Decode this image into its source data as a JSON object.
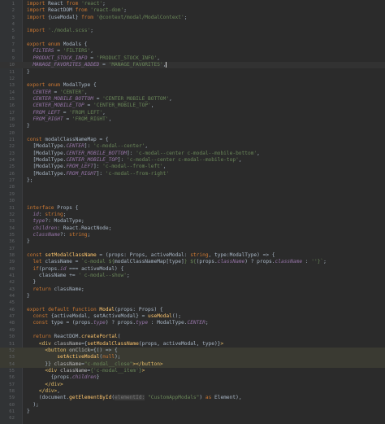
{
  "editor": {
    "theme": {
      "background": "#2b2b2b",
      "gutter": "#313335",
      "highlight_line": "#3a3a32",
      "keyword": "#cc7832",
      "string": "#6a8759",
      "property": "#9876aa",
      "function": "#ffc66d",
      "tag": "#e8bf6a",
      "default": "#a9b7c6"
    },
    "lines": [
      {
        "n": "1",
        "t": [
          [
            "kw",
            "import "
          ],
          [
            "",
            "React "
          ],
          [
            "kw",
            "from "
          ],
          [
            "str",
            "'react'"
          ],
          [
            "",
            ";"
          ]
        ]
      },
      {
        "n": "2",
        "t": [
          [
            "kw",
            "import "
          ],
          [
            "",
            "ReactDOM "
          ],
          [
            "kw",
            "from "
          ],
          [
            "str",
            "'react-dom'"
          ],
          [
            "",
            ";"
          ]
        ]
      },
      {
        "n": "3",
        "t": [
          [
            "kw",
            "import "
          ],
          [
            "",
            "{useModal} "
          ],
          [
            "kw",
            "from "
          ],
          [
            "str",
            "'@context/modal/ModalContext'"
          ],
          [
            "",
            ";"
          ]
        ]
      },
      {
        "n": "4",
        "t": []
      },
      {
        "n": "5",
        "t": [
          [
            "kw",
            "import "
          ],
          [
            "str",
            "'./modal.scss'"
          ],
          [
            "",
            ";"
          ]
        ]
      },
      {
        "n": "6",
        "t": []
      },
      {
        "n": "7",
        "t": [
          [
            "kw",
            "export enum "
          ],
          [
            "",
            "Modals {"
          ]
        ]
      },
      {
        "n": "8",
        "t": [
          [
            "",
            "  "
          ],
          [
            "prop",
            "FILTERS"
          ],
          [
            "",
            " = "
          ],
          [
            "str",
            "'FILTERS'"
          ],
          [
            "",
            ","
          ]
        ]
      },
      {
        "n": "9",
        "t": [
          [
            "",
            "  "
          ],
          [
            "prop",
            "PRODUCT_STOCK_INFO"
          ],
          [
            "",
            " = "
          ],
          [
            "str",
            "'PRODUCT_STOCK_INFO'"
          ],
          [
            "",
            ","
          ]
        ]
      },
      {
        "n": "10",
        "t": [
          [
            "",
            "  "
          ],
          [
            "prop",
            "MANAGE_FAVORITES_ADDED"
          ],
          [
            "",
            " = "
          ],
          [
            "str",
            "'MANAGE_FAVORITES'"
          ],
          [
            "",
            ","
          ]
        ],
        "cur": true
      },
      {
        "n": "11",
        "t": [
          [
            "",
            "}"
          ]
        ]
      },
      {
        "n": "12",
        "t": []
      },
      {
        "n": "13",
        "t": [
          [
            "kw",
            "export enum "
          ],
          [
            "",
            "ModalType {"
          ]
        ]
      },
      {
        "n": "14",
        "t": [
          [
            "",
            "  "
          ],
          [
            "prop",
            "CENTER"
          ],
          [
            "",
            " = "
          ],
          [
            "str",
            "'CENTER'"
          ],
          [
            "",
            ","
          ]
        ]
      },
      {
        "n": "15",
        "t": [
          [
            "",
            "  "
          ],
          [
            "prop",
            "CENTER_MOBILE_BOTTOM"
          ],
          [
            "",
            " = "
          ],
          [
            "str",
            "'CENTER_MOBILE_BOTTOM'"
          ],
          [
            "",
            ","
          ]
        ]
      },
      {
        "n": "16",
        "t": [
          [
            "",
            "  "
          ],
          [
            "prop",
            "CENTER_MOBILE_TOP"
          ],
          [
            "",
            " = "
          ],
          [
            "str",
            "'CENTER_MOBILE_TOP'"
          ],
          [
            "",
            ","
          ]
        ]
      },
      {
        "n": "17",
        "t": [
          [
            "",
            "  "
          ],
          [
            "prop",
            "FROM_LEFT"
          ],
          [
            "",
            " = "
          ],
          [
            "str",
            "'FROM_LEFT'"
          ],
          [
            "",
            ","
          ]
        ]
      },
      {
        "n": "18",
        "t": [
          [
            "",
            "  "
          ],
          [
            "prop",
            "FROM_RIGHT"
          ],
          [
            "",
            " = "
          ],
          [
            "str",
            "'FROM_RIGHT'"
          ],
          [
            "",
            ","
          ]
        ]
      },
      {
        "n": "19",
        "t": [
          [
            "",
            "}"
          ]
        ]
      },
      {
        "n": "20",
        "t": []
      },
      {
        "n": "21",
        "t": [
          [
            "kw",
            "const "
          ],
          [
            "",
            "modalClassNameMap = {"
          ]
        ]
      },
      {
        "n": "22",
        "t": [
          [
            "",
            "  [ModalType."
          ],
          [
            "prop",
            "CENTER"
          ],
          [
            "",
            "]: "
          ],
          [
            "str",
            "'c-modal--center'"
          ],
          [
            "",
            ","
          ]
        ]
      },
      {
        "n": "23",
        "t": [
          [
            "",
            "  [ModalType."
          ],
          [
            "prop",
            "CENTER_MOBILE_BOTTOM"
          ],
          [
            "",
            "]: "
          ],
          [
            "str",
            "'c-modal--center c-modal--mobile-bottom'"
          ],
          [
            "",
            ","
          ]
        ]
      },
      {
        "n": "24",
        "t": [
          [
            "",
            "  [ModalType."
          ],
          [
            "prop",
            "CENTER_MOBILE_TOP"
          ],
          [
            "",
            "]: "
          ],
          [
            "str",
            "'c-modal--center c-modal--mobile-top'"
          ],
          [
            "",
            ","
          ]
        ]
      },
      {
        "n": "25",
        "t": [
          [
            "",
            "  [ModalType."
          ],
          [
            "prop",
            "FROM_LEFT"
          ],
          [
            "",
            "]: "
          ],
          [
            "str",
            "'c-modal--from-left'"
          ],
          [
            "",
            ","
          ]
        ]
      },
      {
        "n": "26",
        "t": [
          [
            "",
            "  [ModalType."
          ],
          [
            "prop",
            "FROM_RIGHT"
          ],
          [
            "",
            "]: "
          ],
          [
            "str",
            "'c-modal--from-right'"
          ]
        ]
      },
      {
        "n": "27",
        "t": [
          [
            "",
            "}"
          ],
          [
            "",
            ";"
          ]
        ]
      },
      {
        "n": "28",
        "t": []
      },
      {
        "n": "29",
        "t": []
      },
      {
        "n": "30",
        "t": []
      },
      {
        "n": "31",
        "t": [
          [
            "kw",
            "interface "
          ],
          [
            "",
            "Props {"
          ]
        ]
      },
      {
        "n": "32",
        "t": [
          [
            "",
            "  "
          ],
          [
            "prop",
            "id"
          ],
          [
            "",
            ": "
          ],
          [
            "kw",
            "string"
          ],
          [
            "",
            ";"
          ]
        ]
      },
      {
        "n": "33",
        "t": [
          [
            "",
            "  "
          ],
          [
            "prop",
            "type"
          ],
          [
            "",
            "?: ModalType;"
          ]
        ]
      },
      {
        "n": "34",
        "t": [
          [
            "",
            "  "
          ],
          [
            "prop",
            "children"
          ],
          [
            "",
            ": React.ReactNode;"
          ]
        ]
      },
      {
        "n": "35",
        "t": [
          [
            "",
            "  "
          ],
          [
            "prop",
            "className"
          ],
          [
            "",
            "?: "
          ],
          [
            "kw",
            "string"
          ],
          [
            "",
            ";"
          ]
        ]
      },
      {
        "n": "36",
        "t": [
          [
            "",
            "}"
          ]
        ]
      },
      {
        "n": "37",
        "t": []
      },
      {
        "n": "38",
        "t": [
          [
            "kw",
            "const "
          ],
          [
            "fn",
            "setModalClassName"
          ],
          [
            "",
            " = (props: Props, activeModal: "
          ],
          [
            "kw",
            "string"
          ],
          [
            "",
            ", type:ModalType) => {"
          ]
        ]
      },
      {
        "n": "39",
        "t": [
          [
            "",
            "  "
          ],
          [
            "kw",
            "let "
          ],
          [
            "",
            "className = "
          ],
          [
            "str",
            "`c-modal ${"
          ],
          [
            "",
            "modalClassNameMap[type]"
          ],
          [
            "str",
            "} ${"
          ],
          [
            "",
            "(props."
          ],
          [
            "prop",
            "className"
          ],
          [
            "",
            ") ? props."
          ],
          [
            "prop",
            "className"
          ],
          [
            "",
            " : "
          ],
          [
            "str",
            "''"
          ],
          [
            "str",
            "}`"
          ],
          [
            "",
            ";"
          ]
        ]
      },
      {
        "n": "40",
        "t": [
          [
            "",
            "  "
          ],
          [
            "kw",
            "if"
          ],
          [
            "",
            "(props."
          ],
          [
            "prop",
            "id"
          ],
          [
            "",
            " === activeModal) {"
          ]
        ]
      },
      {
        "n": "41",
        "t": [
          [
            "",
            "    className += "
          ],
          [
            "str",
            "' c-modal--show'"
          ],
          [
            "",
            ";"
          ]
        ]
      },
      {
        "n": "42",
        "t": [
          [
            "",
            "  }"
          ]
        ]
      },
      {
        "n": "43",
        "t": [
          [
            "",
            "  "
          ],
          [
            "kw",
            "return "
          ],
          [
            "",
            "className;"
          ]
        ]
      },
      {
        "n": "44",
        "t": [
          [
            "",
            "}"
          ]
        ]
      },
      {
        "n": "45",
        "t": []
      },
      {
        "n": "46",
        "t": [
          [
            "kw",
            "export default function "
          ],
          [
            "fn",
            "Modal"
          ],
          [
            "",
            "(props: Props) {"
          ]
        ]
      },
      {
        "n": "47",
        "t": [
          [
            "",
            "  "
          ],
          [
            "kw",
            "const "
          ],
          [
            "",
            "{activeModal, setActiveModal} = "
          ],
          [
            "fn",
            "useModal"
          ],
          [
            "",
            "();"
          ]
        ]
      },
      {
        "n": "48",
        "t": [
          [
            "",
            "  "
          ],
          [
            "kw",
            "const "
          ],
          [
            "",
            "type = (props."
          ],
          [
            "prop",
            "type"
          ],
          [
            "",
            ") ? props."
          ],
          [
            "prop",
            "type"
          ],
          [
            "",
            " : ModalType."
          ],
          [
            "prop",
            "CENTER"
          ],
          [
            "",
            ";"
          ]
        ]
      },
      {
        "n": "49",
        "t": []
      },
      {
        "n": "50",
        "t": [
          [
            "",
            "  "
          ],
          [
            "kw",
            "return "
          ],
          [
            "",
            "ReactDOM."
          ],
          [
            "fn",
            "createPortal"
          ],
          [
            "",
            "("
          ]
        ]
      },
      {
        "n": "51",
        "t": [
          [
            "",
            "    "
          ],
          [
            "tag",
            "<div "
          ],
          [
            "attr",
            "className"
          ],
          [
            "",
            "={"
          ],
          [
            "fn",
            "setModalClassName"
          ],
          [
            "",
            "(props, activeModal, type)}"
          ],
          [
            "tag",
            ">"
          ]
        ]
      },
      {
        "n": "52",
        "t": [
          [
            "",
            "      "
          ],
          [
            "tag",
            "<button "
          ],
          [
            "attr",
            "onClick"
          ],
          [
            "",
            "={() => {"
          ]
        ],
        "hl": true
      },
      {
        "n": "53",
        "t": [
          [
            "",
            "          "
          ],
          [
            "fn",
            "setActiveModal"
          ],
          [
            "",
            "("
          ],
          [
            "kw",
            "null"
          ],
          [
            "",
            ");"
          ]
        ],
        "hl": true
      },
      {
        "n": "54",
        "t": [
          [
            "",
            "      }} "
          ],
          [
            "attr",
            "className"
          ],
          [
            "",
            "="
          ],
          [
            "str",
            "\"c-modal__close\""
          ],
          [
            "tag",
            "></button>"
          ]
        ],
        "hl": true
      },
      {
        "n": "55",
        "t": [
          [
            "",
            "      "
          ],
          [
            "tag",
            "<div "
          ],
          [
            "attr",
            "className"
          ],
          [
            "",
            "="
          ],
          [
            "str",
            "{'c-modal__item'}"
          ],
          [
            "tag",
            ">"
          ]
        ]
      },
      {
        "n": "56",
        "t": [
          [
            "",
            "        {props."
          ],
          [
            "prop",
            "children"
          ],
          [
            "",
            "}"
          ]
        ]
      },
      {
        "n": "57",
        "t": [
          [
            "",
            "      "
          ],
          [
            "tag",
            "</div>"
          ]
        ]
      },
      {
        "n": "58",
        "t": [
          [
            "",
            "    "
          ],
          [
            "tag",
            "</div>"
          ],
          [
            "",
            ","
          ]
        ]
      },
      {
        "n": "59",
        "t": [
          [
            "",
            "    (document."
          ],
          [
            "fn",
            "getElementById"
          ],
          [
            "",
            "("
          ],
          [
            "hint",
            "elementId:"
          ],
          [
            "",
            " "
          ],
          [
            "str",
            "\"CustomAppModals\""
          ],
          [
            "",
            ") "
          ],
          [
            "kw",
            "as "
          ],
          [
            "",
            "Element),"
          ]
        ]
      },
      {
        "n": "60",
        "t": [
          [
            "",
            "  );"
          ]
        ]
      },
      {
        "n": "61",
        "t": [
          [
            "",
            "}"
          ]
        ]
      },
      {
        "n": "62",
        "t": []
      }
    ]
  }
}
